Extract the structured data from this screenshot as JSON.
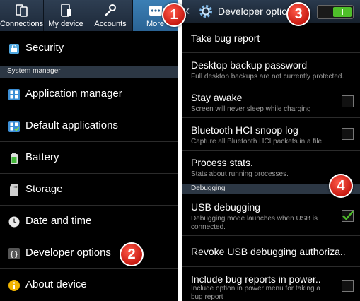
{
  "left": {
    "tabs": [
      {
        "label": "Connections",
        "icon": "connections-icon"
      },
      {
        "label": "My device",
        "icon": "my-device-icon"
      },
      {
        "label": "Accounts",
        "icon": "accounts-icon"
      },
      {
        "label": "More",
        "icon": "more-icon",
        "active": true
      }
    ],
    "items": [
      {
        "label": "Security",
        "icon": "lock-icon"
      },
      {
        "label": "Application manager",
        "icon": "grid-icon"
      },
      {
        "label": "Default applications",
        "icon": "default-apps-icon"
      },
      {
        "label": "Battery",
        "icon": "battery-icon"
      },
      {
        "label": "Storage",
        "icon": "storage-icon"
      },
      {
        "label": "Date and time",
        "icon": "clock-icon"
      },
      {
        "label": "Developer options",
        "icon": "braces-icon"
      },
      {
        "label": "About device",
        "icon": "info-icon"
      }
    ],
    "section_header": "System manager"
  },
  "right": {
    "header": {
      "title": "Developer options",
      "toggle_on": true
    },
    "items": [
      {
        "title": "Take bug report",
        "subtitle": ""
      },
      {
        "title": "Desktop backup password",
        "subtitle": "Full desktop backups are not currently protected."
      },
      {
        "title": "Stay awake",
        "subtitle": "Screen will never sleep while charging",
        "checked": false
      },
      {
        "title": "Bluetooth HCI snoop log",
        "subtitle": "Capture all Bluetooth HCI packets in a file.",
        "checked": false
      },
      {
        "title": "Process stats.",
        "subtitle": "Stats about running processes."
      },
      {
        "title": "USB debugging",
        "subtitle": "Debugging mode launches when USB is connected.",
        "checked": true
      },
      {
        "title": "Revoke USB debugging authoriza..",
        "subtitle": ""
      },
      {
        "title": "Include bug reports in power..",
        "subtitle": "Include option in power menu for taking a bug report",
        "checked": false
      }
    ],
    "section_header": "Debugging"
  },
  "markers": [
    "1",
    "2",
    "3",
    "4"
  ],
  "colors": {
    "accent": "#3b7fb5",
    "marker": "#d62a1e",
    "check": "#4fbf2a"
  }
}
